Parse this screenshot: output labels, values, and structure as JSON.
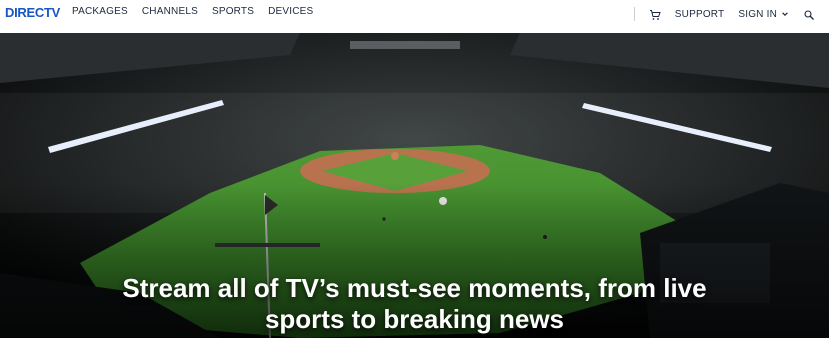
{
  "brand": {
    "logo_text": "DIRECTV",
    "accent": "#1a55c4"
  },
  "nav": {
    "primary": [
      "PACKAGES",
      "CHANNELS",
      "SPORTS",
      "DEVICES"
    ],
    "support_label": "SUPPORT",
    "signin_label": "SIGN IN",
    "icons": {
      "cart": "cart-icon",
      "signin_caret": "chevron-down-icon",
      "search": "search-icon"
    }
  },
  "hero": {
    "headline_line1": "Stream all of TV’s must-see moments, from live",
    "headline_line2": "sports to breaking news"
  }
}
